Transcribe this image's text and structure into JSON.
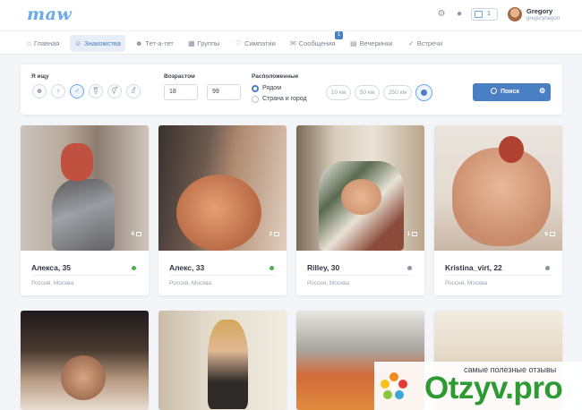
{
  "app": {
    "logo": "maw"
  },
  "header": {
    "wallet_value": "1",
    "user": {
      "name": "Gregory",
      "handle": "gregoryhegun"
    }
  },
  "nav": {
    "items": [
      {
        "label": "Главная",
        "icon": "home-icon"
      },
      {
        "label": "Знакомства",
        "icon": "user-icon",
        "active": true
      },
      {
        "label": "Тет-а-тет",
        "icon": "users-icon"
      },
      {
        "label": "Группы",
        "icon": "groups-icon"
      },
      {
        "label": "Симпатии",
        "icon": "heart-icon"
      },
      {
        "label": "Сообщения",
        "icon": "mail-icon",
        "badge": "1"
      },
      {
        "label": "Вечеринки",
        "icon": "calendar-icon"
      },
      {
        "label": "Встречи",
        "icon": "check-icon"
      }
    ]
  },
  "filter": {
    "seeking_label": "Я ищу",
    "age_label": "Возрастом",
    "age_from": "18",
    "age_to": "99",
    "location_label": "Расположенные",
    "radio_nearby": "Рядом",
    "radio_country": "Страна и город",
    "radius_options": [
      "10 км",
      "50 км",
      "250 км"
    ],
    "search_label": "Поиск"
  },
  "cards": [
    {
      "name": "Алекса, 35",
      "location": "Россия, Москва",
      "photos": "4",
      "online": true
    },
    {
      "name": "Алекс, 33",
      "location": "Россия, Москва",
      "photos": "3",
      "online": true
    },
    {
      "name": "Rilley, 30",
      "location": "Россия, Москва",
      "photos": "1",
      "online": false
    },
    {
      "name": "Kristina_virt, 22",
      "location": "Россия, Москва",
      "photos": "6",
      "online": false
    }
  ],
  "watermark": {
    "tagline": "самые полезные отзывы",
    "brand": "Otzyv.pro"
  },
  "colors": {
    "accent": "#4a7fc4",
    "online": "#4caf50",
    "offline": "#8a93a3"
  }
}
